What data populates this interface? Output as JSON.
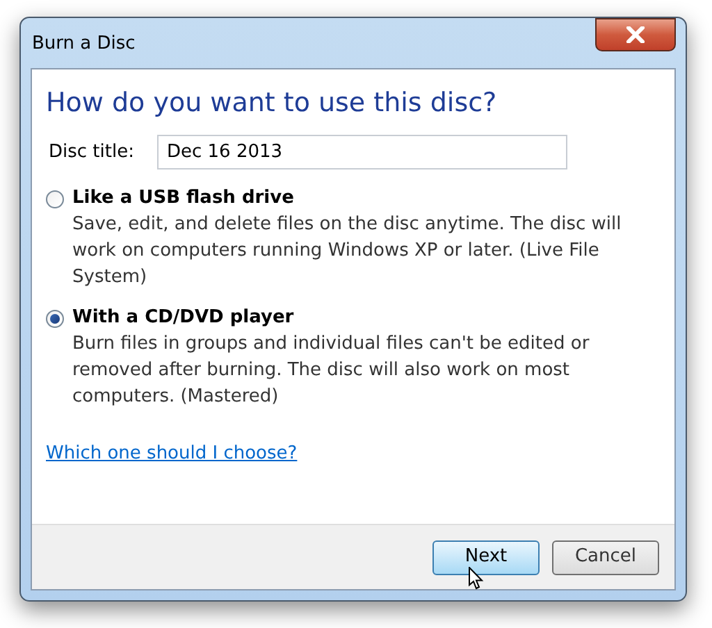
{
  "window": {
    "title": "Burn a Disc"
  },
  "heading": "How do you want to use this disc?",
  "disc_title": {
    "label": "Disc title:",
    "value": "Dec 16 2013"
  },
  "options": [
    {
      "label": "Like a USB flash drive",
      "description": "Save, edit, and delete files on the disc anytime. The disc will work on computers running Windows XP or later. (Live File System)",
      "selected": false
    },
    {
      "label": "With a CD/DVD player",
      "description": "Burn files in groups and individual files can't be edited or removed after burning. The disc will also work on most computers. (Mastered)",
      "selected": true
    }
  ],
  "help_link": "Which one should I choose?",
  "buttons": [
    {
      "label": "Next",
      "highlighted": true
    },
    {
      "label": "Cancel",
      "highlighted": false
    }
  ]
}
